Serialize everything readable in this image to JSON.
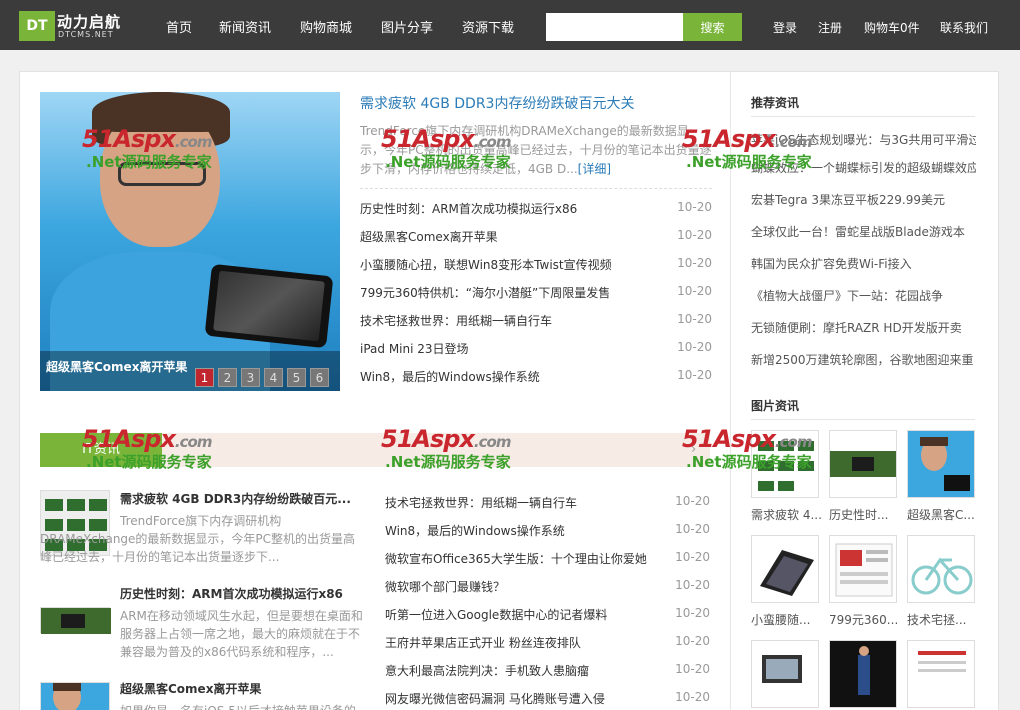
{
  "logo": {
    "box": "DT",
    "cn": "动力启航",
    "en": "DTCMS.NET"
  },
  "nav": [
    "首页",
    "新闻资讯",
    "购物商城",
    "图片分享",
    "资源下载"
  ],
  "search": {
    "placeholder": "",
    "button": "搜索"
  },
  "util": [
    "登录",
    "注册",
    "购物车0件",
    "联系我们"
  ],
  "slider": {
    "caption": "超级黑客Comex离开苹果",
    "pages": [
      "1",
      "2",
      "3",
      "4",
      "5",
      "6"
    ],
    "active_page": 1
  },
  "headline": {
    "title": "需求疲软 4GB DDR3内存纷纷跌破百元大关",
    "summary": "TrendForce旗下内存调研机构DRAMeXchange的最新数据显示，今年PC整机的出货量高峰已经过去，十月份的笔记本出货量逐步下滑，内存价格也持续走低，4GB D...",
    "more": "[详细]"
  },
  "top_list": [
    {
      "title": "历史性时刻：ARM首次成功模拟运行x86",
      "date": "10-20"
    },
    {
      "title": "超级黑客Comex离开苹果",
      "date": "10-20"
    },
    {
      "title": "小蛮腰随心扭，联想Win8变形本Twist宣传视频",
      "date": "10-20"
    },
    {
      "title": "799元360特供机：“海尔小潜艇”下周限量发售",
      "date": "10-20"
    },
    {
      "title": "技术宅拯救世界：用纸糊一辆自行车",
      "date": "10-20"
    },
    {
      "title": "iPad Mini 23日登场",
      "date": "10-20"
    },
    {
      "title": "Win8，最后的Windows操作系统",
      "date": "10-20"
    }
  ],
  "section": {
    "tab": "IT资讯",
    "arrow": "›"
  },
  "section_news": [
    {
      "title": "需求疲软 4GB DDR3内存纷纷跌破百元...",
      "summary": "TrendForce旗下内存调研机构DRAMeXchange的最新数据显示，今年PC整机的出货量高峰已经过去，十月份的笔记本出货量逐步下..."
    },
    {
      "title": "历史性时刻：ARM首次成功模拟运行x86",
      "summary": "ARM在移动领域风生水起，但是要想在桌面和服务器上占领一席之地，最大的麻烦就在于不兼容最为普及的x86代码系统和程序，..."
    },
    {
      "title": "超级黑客Comex离开苹果",
      "summary": "如果你是一名有iOS 5以后才接触苹果设备的"
    }
  ],
  "section_list": [
    {
      "title": "技术宅拯救世界：用纸糊一辆自行车",
      "date": "10-20"
    },
    {
      "title": "Win8，最后的Windows操作系统",
      "date": "10-20"
    },
    {
      "title": "微软宣布Office365大学生版：十个理由让你爱她",
      "date": "10-20"
    },
    {
      "title": "微软哪个部门最赚钱？",
      "date": "10-20"
    },
    {
      "title": "听第一位进入Google数据中心的记者爆料",
      "date": "10-20"
    },
    {
      "title": "王府井苹果店正式开业 粉丝连夜排队",
      "date": "10-20"
    },
    {
      "title": "意大利最高法院判决：手机致人患脑瘤",
      "date": "10-20"
    },
    {
      "title": "网友曝光微信密码漏洞 马化腾账号遭入侵",
      "date": "10-20"
    }
  ],
  "sidebar": {
    "recommend_title": "推荐资讯",
    "recommend": [
      "苹果iOS生态规划曝光：与3G共用可平滑过",
      "蝴蝶效应：一个蝴蝶标引发的超级蝴蝶效应",
      "宏碁Tegra 3果冻豆平板229.99美元",
      "全球仅此一台！雷蛇星战版Blade游戏本",
      "韩国为民众扩容免费Wi-Fi接入",
      "《植物大战僵尸》下一站：花园战争",
      "无锁随便刷：摩托RAZR HD开发版开卖",
      "新增2500万建筑轮廓图，谷歌地图迎来重"
    ],
    "pics_title": "图片资讯",
    "pics": [
      "需求疲软 4...",
      "历史性时...",
      "超级黑客C...",
      "小蛮腰随...",
      "799元360...",
      "技术宅拯..."
    ]
  },
  "watermark": {
    "brand_a": "51Aspx",
    "brand_b": ".com",
    "tagline": ".Net源码服务专家"
  },
  "colors": {
    "accent_green": "#7ab53a",
    "link_blue": "#2a7bb7",
    "topbar": "#3b3b3b",
    "active_dot": "#c0262d"
  }
}
